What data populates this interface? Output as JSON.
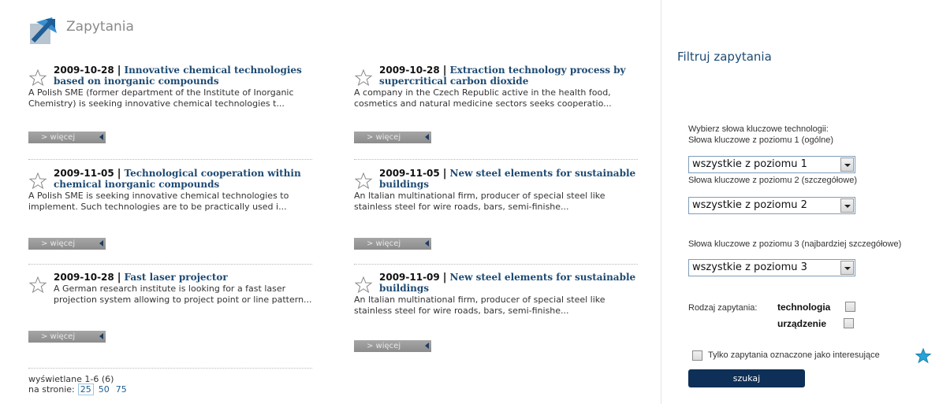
{
  "header": {
    "title": "Zapytania"
  },
  "items": [
    {
      "date": "2009-10-28",
      "title": "Innovative chemical technologies based on inorganic compounds",
      "desc": "A Polish SME (former department of the Institute of Inorganic Chemistry) is seeking innovative chemical technologies t...",
      "more": "> więcej"
    },
    {
      "date": "2009-10-28",
      "title": "Extraction technology process by supercritical carbon dioxide",
      "desc": "A company in the Czech Republic active in the health food, cosmetics and natural medicine sectors seeks cooperatio...",
      "more": "> więcej"
    },
    {
      "date": "2009-11-05",
      "title": "Technological cooperation within chemical inorganic compounds",
      "desc": "A Polish SME is seeking innovative chemical technologies to implement. Such technologies are to be practically used i...",
      "more": "> więcej"
    },
    {
      "date": "2009-11-05",
      "title": "New steel elements for sustainable buildings",
      "desc": "An Italian multinational firm, producer of special steel like stainless steel for wire roads, bars, semi-finishe...",
      "more": "> więcej"
    },
    {
      "date": "2009-10-28",
      "title": "Fast laser projector",
      "desc": "A German research institute is looking for a fast laser projection system allowing to project point or line pattern...",
      "more": "> więcej"
    },
    {
      "date": "2009-11-09",
      "title": "New steel elements for sustainable buildings",
      "desc": "An Italian multinational firm, producer of special steel like stainless steel for wire roads, bars, semi-finishe...",
      "more": "> więcej"
    }
  ],
  "pager": {
    "shown": "wyświetlane 1-6 (6)",
    "per_page_label": "na stronie:",
    "options": [
      "25",
      "50",
      "75"
    ]
  },
  "filter": {
    "title": "Filtruj zapytania",
    "intro": "Wybierz słowa kluczowe technologii:",
    "level1_label": "Słowa kluczowe z poziomu 1 (ogólne)",
    "level1_value": "wszystkie z poziomu 1",
    "level2_label": "Słowa kluczowe z poziomu 2 (szczegółowe)",
    "level2_value": "wszystkie z poziomu 2",
    "level3_label": "Słowa kluczowe z poziomu 3 (najbardziej szczegółowe)",
    "level3_value": "wszystkie z poziomu 3",
    "type_label": "Rodzaj zapytania:",
    "type_tech": "technologia",
    "type_device": "urządzenie",
    "interesting_label": "Tylko zapytania oznaczone jako interesujące",
    "search_button": "szukaj"
  },
  "colors": {
    "accent": "#1d4a73",
    "button": "#0e2f57",
    "more_button": "#999999",
    "star": "#29a3d6"
  }
}
